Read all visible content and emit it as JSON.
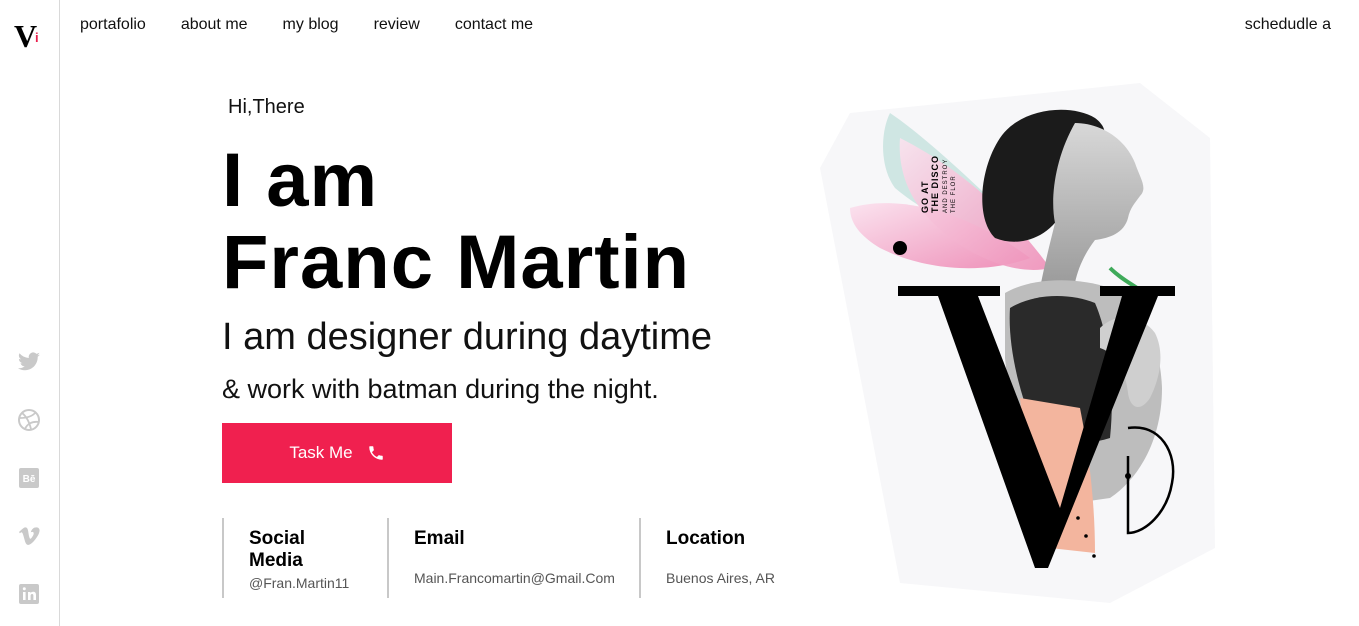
{
  "logo": {
    "letter": "V",
    "accent": "i"
  },
  "nav": {
    "items": [
      "portafolio",
      "about me",
      "my blog",
      "review",
      "contact me"
    ],
    "schedule": "schedudle a"
  },
  "sidebar": {
    "social_icons": [
      "twitter-icon",
      "dribbble-icon",
      "behance-icon",
      "vimeo-icon",
      "linkedin-icon"
    ]
  },
  "hero": {
    "greeting": "Hi,There",
    "headline_line1": "I am",
    "headline_line2": "Franc Martin",
    "tagline_1": "I am designer during daytime",
    "tagline_2": "& work with batman during the night.",
    "cta_label": "Task Me"
  },
  "info": {
    "social": {
      "title": "Social Media",
      "value": "@Fran.Martin11"
    },
    "email": {
      "title": "Email",
      "value": "Main.Francomartin@Gmail.Com"
    },
    "location": {
      "title": "Location",
      "value": "Buenos Aires, AR"
    }
  },
  "art": {
    "poster_text_1": "GO AT",
    "poster_text_2": "THE DISCO",
    "poster_text_3": "AND DESTROY",
    "poster_text_4": "THE FLOR"
  },
  "colors": {
    "accent": "#f0204f",
    "text": "#111111",
    "icon_gray": "#c9c9c9",
    "divider": "#c8c8c8"
  }
}
